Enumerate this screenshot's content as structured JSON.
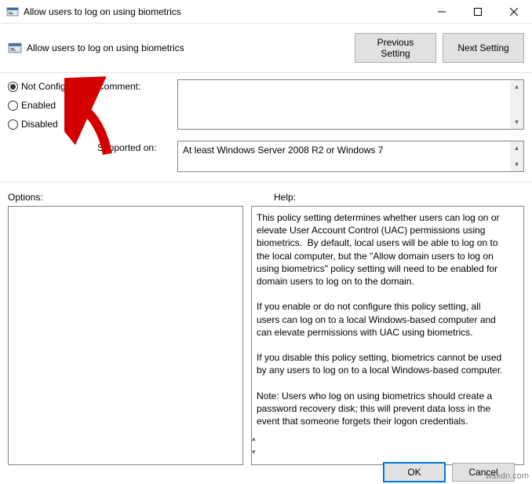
{
  "window": {
    "title": "Allow users to log on using biometrics"
  },
  "header": {
    "heading": "Allow users to log on using biometrics",
    "prev_label": "Previous Setting",
    "next_label": "Next Setting"
  },
  "state": {
    "not_configured": "Not Configured",
    "enabled": "Enabled",
    "disabled": "Disabled",
    "selected": "not_configured"
  },
  "labels": {
    "comment": "Comment:",
    "supported_on": "Supported on:",
    "options": "Options:",
    "help": "Help:"
  },
  "supported_text": "At least Windows Server 2008 R2 or Windows 7",
  "help_text": "This policy setting determines whether users can log on or elevate User Account Control (UAC) permissions using biometrics.  By default, local users will be able to log on to the local computer, but the \"Allow domain users to log on using biometrics\" policy setting will need to be enabled for domain users to log on to the domain.\n\nIf you enable or do not configure this policy setting, all users can log on to a local Windows-based computer and can elevate permissions with UAC using biometrics.\n\nIf you disable this policy setting, biometrics cannot be used by any users to log on to a local Windows-based computer.\n\nNote: Users who log on using biometrics should create a password recovery disk; this will prevent data loss in the event that someone forgets their logon credentials.",
  "footer": {
    "ok": "OK",
    "cancel": "Cancel"
  },
  "watermark": "wsxdn.com"
}
